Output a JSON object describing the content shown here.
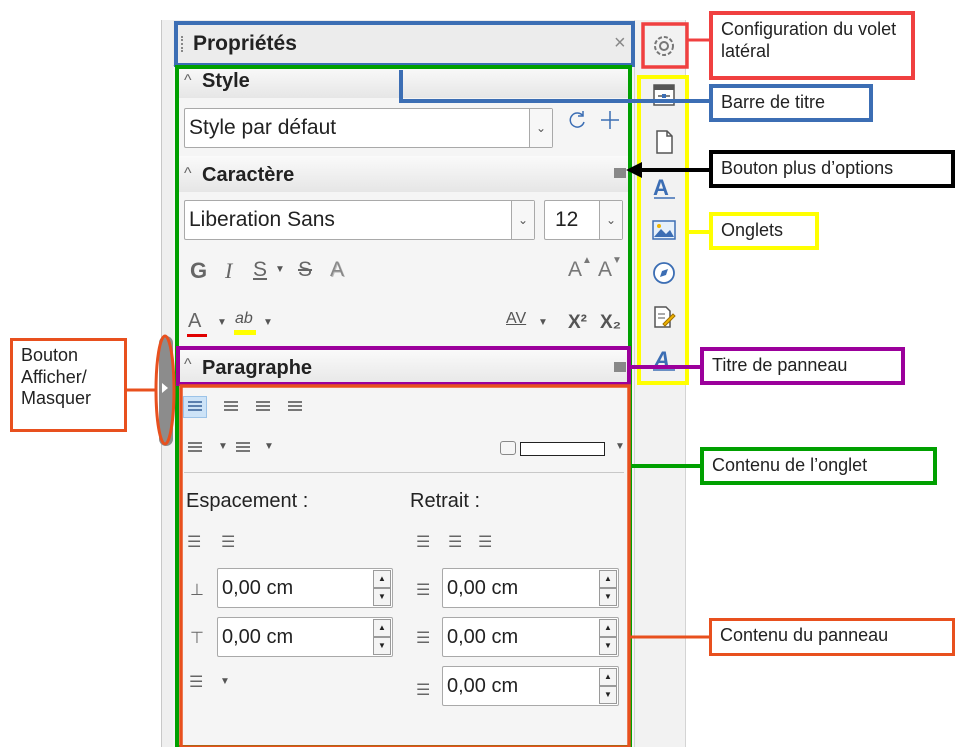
{
  "sidebar": {
    "title": "Propriétés",
    "close_glyph": "×",
    "sections": {
      "style": {
        "title": "Style",
        "value": "Style par défaut"
      },
      "caractere": {
        "title": "Caractère",
        "font": "Liberation Sans",
        "size": "12",
        "bold": "G",
        "italic": "I",
        "underline": "S",
        "strike": "S",
        "shadow": "A",
        "grow": "A",
        "shrink": "A",
        "font_color": "A",
        "highlight": "ab",
        "spacing": "AV",
        "superscript": "X²",
        "subscript": "X₂"
      },
      "paragraphe": {
        "title": "Paragraphe",
        "espacement_label": "Espacement :",
        "retrait_label": "Retrait :",
        "above": "0,00 cm",
        "below": "0,00 cm",
        "indent_before": "0,00 cm",
        "indent_after": "0,00 cm",
        "first_line": "0,00 cm"
      }
    }
  },
  "callouts": {
    "config": "Configuration du volet latéral",
    "titlebar": "Barre de titre",
    "more_options": "Bouton plus d’options",
    "tabs": "Onglets",
    "panel_title": "Titre de panneau",
    "tab_content": "Contenu de l’onglet",
    "panel_content": "Contenu du panneau",
    "show_hide": "Bouton Afficher/ Masquer"
  },
  "colors": {
    "red": "#f04040",
    "blue": "#3c6eb4",
    "green": "#00a000",
    "yellow": "#ffff00",
    "purple": "#9b009b",
    "orange": "#e8501e",
    "black": "#000000"
  }
}
